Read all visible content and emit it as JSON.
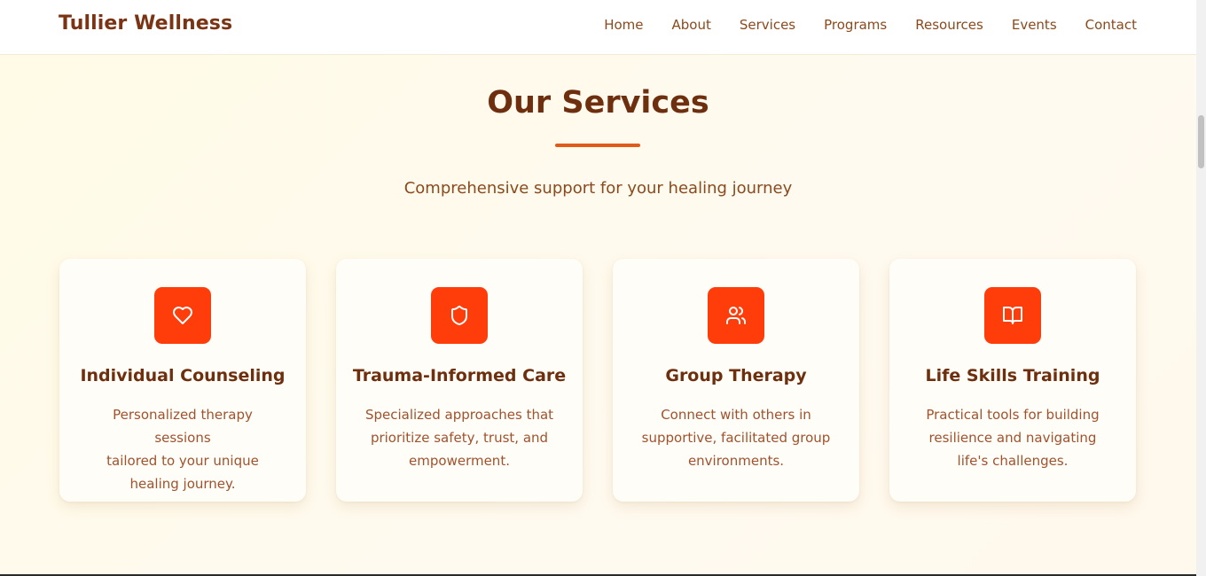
{
  "brand": "Tullier Wellness",
  "nav": [
    "Home",
    "About",
    "Services",
    "Programs",
    "Resources",
    "Events",
    "Contact"
  ],
  "section": {
    "title": "Our Services",
    "subtitle": "Comprehensive support for your healing journey"
  },
  "cards": [
    {
      "icon": "heart-icon",
      "title": "Individual Counseling",
      "desc_lines": [
        "Personalized therapy sessions",
        "tailored to your unique",
        "healing journey."
      ]
    },
    {
      "icon": "shield-icon",
      "title": "Trauma-Informed Care",
      "desc_lines": [
        "Specialized approaches that",
        "prioritize safety, trust, and",
        "empowerment."
      ]
    },
    {
      "icon": "users-icon",
      "title": "Group Therapy",
      "desc_lines": [
        "Connect with others in",
        "supportive, facilitated group",
        "environments."
      ]
    },
    {
      "icon": "book-open-icon",
      "title": "Life Skills Training",
      "desc_lines": [
        "Practical tools for building",
        "resilience and navigating",
        "life's challenges."
      ]
    }
  ],
  "colors": {
    "accent": "#ff3d0a",
    "brand_text": "#7a3414",
    "body_text": "#a0522d",
    "background": "#fffbea"
  }
}
